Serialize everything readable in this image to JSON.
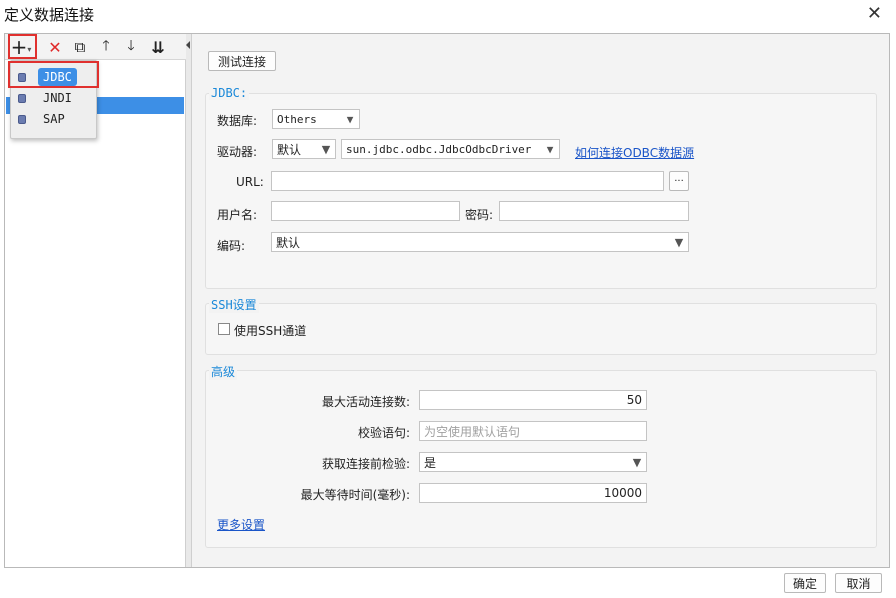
{
  "window": {
    "title": "定义数据连接",
    "close_glyph": "✕"
  },
  "toolbar": {
    "add_glyph": "+",
    "add_caret": "▾",
    "delete_glyph": "✕",
    "copy_glyph": "⧉",
    "up_glyph": "🡑",
    "down_glyph": "🡓",
    "sort_glyph": "⇊"
  },
  "add_menu": {
    "items": [
      "JDBC",
      "JNDI",
      "SAP"
    ]
  },
  "actions": {
    "test_connection": "测试连接"
  },
  "jdbc": {
    "title": "JDBC:",
    "database_label": "数据库:",
    "database_value": "Others",
    "driver_label": "驱动器:",
    "driver_mode": "默认",
    "driver_class": "sun.jdbc.odbc.JdbcOdbcDriver",
    "odbc_link": "如何连接ODBC数据源",
    "url_label": "URL:",
    "url_value": "",
    "url_browse": "···",
    "username_label": "用户名:",
    "username_value": "",
    "password_label": "密码:",
    "password_value": "",
    "encoding_label": "编码:",
    "encoding_value": "默认"
  },
  "ssh": {
    "title": "SSH设置",
    "use_tunnel_label": "使用SSH通道",
    "use_tunnel_checked": false
  },
  "advanced": {
    "title": "高级",
    "max_active_label": "最大活动连接数:",
    "max_active_value": "50",
    "validation_query_label": "校验语句:",
    "validation_query_placeholder": "为空使用默认语句",
    "test_before_borrow_label": "获取连接前检验:",
    "test_before_borrow_value": "是",
    "max_wait_label": "最大等待时间(毫秒):",
    "max_wait_value": "10000",
    "more_settings": "更多设置"
  },
  "footer": {
    "ok": "确定",
    "cancel": "取消"
  }
}
